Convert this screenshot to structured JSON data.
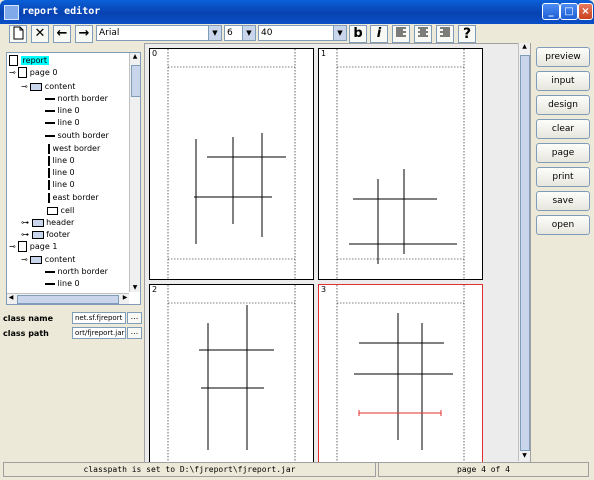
{
  "window": {
    "title": "report editor",
    "min_label": "_",
    "max_label": "□",
    "close_label": "×"
  },
  "toolbar": {
    "new_icon": "new-page-icon",
    "delete_label": "✕",
    "back_label": "←",
    "forward_label": "→",
    "font_value": "Arial",
    "size_value": "6",
    "zoom_value": "40",
    "bold_label": "b",
    "italic_label": "i",
    "help_label": "?"
  },
  "tree": {
    "nodes": [
      {
        "label": "report",
        "selected": true
      },
      {
        "label": "page 0"
      },
      {
        "label": "content"
      },
      {
        "label": "north border"
      },
      {
        "label": "line 0"
      },
      {
        "label": "line 0"
      },
      {
        "label": "south border"
      },
      {
        "label": "west border"
      },
      {
        "label": "line 0"
      },
      {
        "label": "line 0"
      },
      {
        "label": "line 0"
      },
      {
        "label": "east border"
      },
      {
        "label": "cell"
      },
      {
        "label": "header"
      },
      {
        "label": "footer"
      },
      {
        "label": "page 1"
      },
      {
        "label": "content"
      },
      {
        "label": "north border"
      },
      {
        "label": "line 0"
      }
    ]
  },
  "props": {
    "class_name_label": "class name",
    "class_name_value": "net.sf.fjreport",
    "class_path_label": "class path",
    "class_path_value": "ort/fjreport.jar",
    "dots": "..."
  },
  "pages": [
    {
      "num": "0"
    },
    {
      "num": "1"
    },
    {
      "num": "2"
    },
    {
      "num": "3"
    }
  ],
  "sidebar": {
    "buttons": [
      "preview",
      "input",
      "design",
      "clear",
      "page",
      "print",
      "save",
      "open"
    ]
  },
  "status": {
    "message": "classpath is set to D:\\fjreport\\fjreport.jar",
    "page_info": "page 4 of 4"
  },
  "colors": {
    "selection": "#00ffff",
    "selected_page_border": "#e03030",
    "titlebar": "#0a5fd8"
  }
}
